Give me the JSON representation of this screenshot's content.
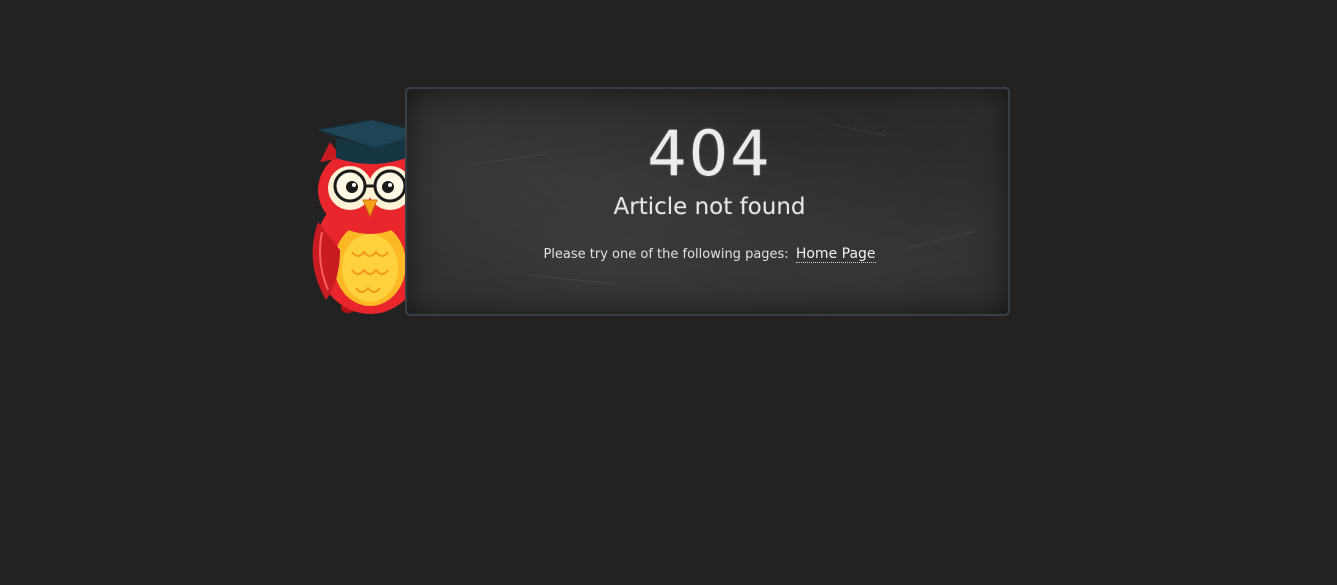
{
  "error": {
    "code": "404",
    "message": "Article not found",
    "hint": "Please try one of the following pages:",
    "links": [
      {
        "label": "Home Page"
      }
    ]
  },
  "colors": {
    "background": "#222222",
    "board": "#2f3030",
    "board_border": "#3a3f46",
    "text": "#ececec"
  },
  "icons": {
    "mascot": "owl-graduate-illustration"
  }
}
